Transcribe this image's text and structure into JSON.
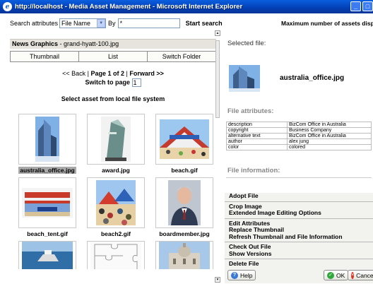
{
  "window": {
    "title": "http://localhost - Media Asset Management - Microsoft Internet Explorer"
  },
  "search": {
    "label": "Search attributes",
    "field": "File Name",
    "by_label": "By",
    "query": "*",
    "button": "Start search"
  },
  "album": {
    "name": "News Graphics",
    "file": "grand-hyatt-100.jpg"
  },
  "view_tabs": [
    "Thumbnail",
    "List",
    "Switch Folder"
  ],
  "pager": {
    "back": "<< Back",
    "page_text": "Page 1 of 2",
    "forward": "Forward >>",
    "switch_label": "Switch to page",
    "page_value": "1",
    "local_label": "Select asset from local file system"
  },
  "assets": [
    {
      "name": "australia_office.jpg",
      "selected": true,
      "icon": "office-tower-photo"
    },
    {
      "name": "award.jpg",
      "selected": false,
      "icon": "glass-award-photo"
    },
    {
      "name": "beach.gif",
      "selected": false,
      "icon": "beach-tent-photo"
    },
    {
      "name": "beach_tent.gif",
      "selected": false,
      "icon": "striped-tent-photo"
    },
    {
      "name": "beach2.gif",
      "selected": false,
      "icon": "beach-crowd-photo"
    },
    {
      "name": "boardmember.jpg",
      "selected": false,
      "icon": "portrait-photo"
    },
    {
      "name": "",
      "icon": "boat-photo"
    },
    {
      "name": "",
      "icon": "puzzle-photo"
    },
    {
      "name": "",
      "icon": "building-photo"
    }
  ],
  "right": {
    "max_assets": "Maximum number of assets displayed",
    "selected_label": "Selected file:",
    "selected_file": "australia_office.jpg",
    "attributes_label": "File attributes:",
    "attributes": [
      [
        "description",
        "BizCom Office in Australia"
      ],
      [
        "copyright",
        "Business Company"
      ],
      [
        "alternative text",
        "BizCom Office in Australia"
      ],
      [
        "author",
        "alex jung"
      ],
      [
        "color",
        "colored"
      ]
    ],
    "information_label": "File information:",
    "actions": [
      [
        "Adopt File"
      ],
      [
        "Crop Image",
        "Extended Image Editing Options"
      ],
      [
        "Edit Attributes",
        "Replace Thumbnail",
        "Refresh Thumbnail and File Information"
      ],
      [
        "Check Out File",
        "Show Versions"
      ],
      [
        "Delete File"
      ]
    ]
  },
  "buttons": {
    "help": "Help",
    "ok": "OK",
    "cancel": "Cancel"
  }
}
